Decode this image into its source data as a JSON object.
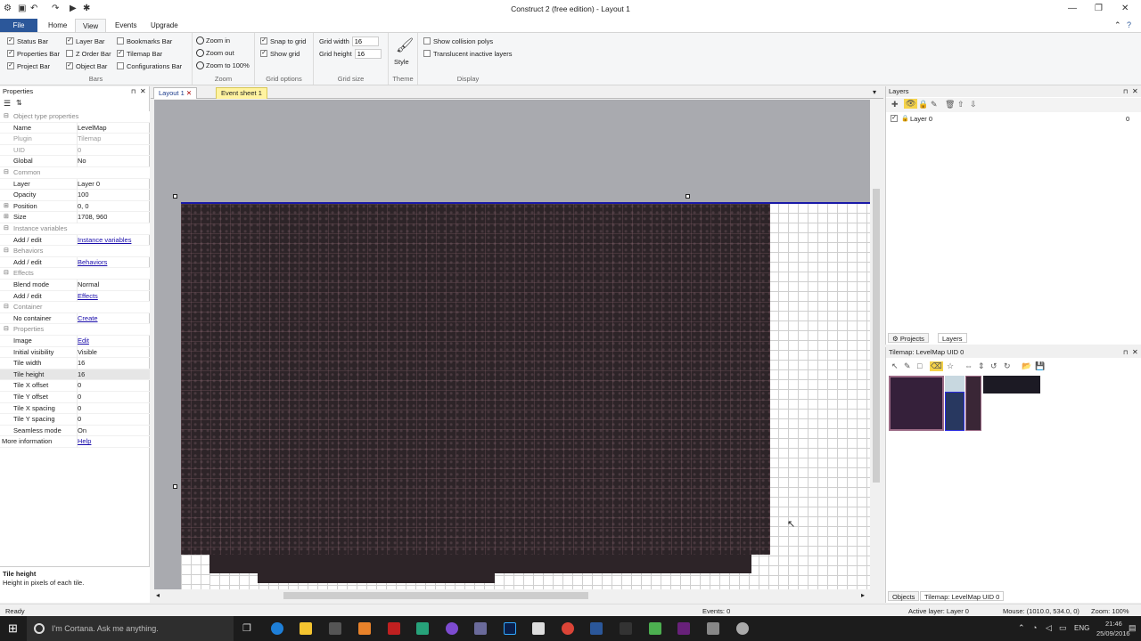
{
  "window": {
    "title": "Construct 2  (free edition) - Layout 1",
    "controls": [
      "minimize-icon",
      "restore-icon",
      "close-icon"
    ]
  },
  "ribbon": {
    "tabs": [
      "File",
      "Home",
      "View",
      "Events",
      "Upgrade"
    ],
    "active_tab": "View",
    "bars": {
      "label": "Bars",
      "items": [
        {
          "label": "Status Bar",
          "checked": true
        },
        {
          "label": "Properties Bar",
          "checked": true
        },
        {
          "label": "Project Bar",
          "checked": true
        },
        {
          "label": "Layer Bar",
          "checked": true
        },
        {
          "label": "Z Order Bar",
          "checked": false
        },
        {
          "label": "Object Bar",
          "checked": true
        },
        {
          "label": "Bookmarks Bar",
          "checked": false
        },
        {
          "label": "Tilemap Bar",
          "checked": true
        },
        {
          "label": "Configurations Bar",
          "checked": false
        }
      ]
    },
    "zoom": {
      "label": "Zoom",
      "items": [
        "Zoom in",
        "Zoom out",
        "Zoom to 100%"
      ]
    },
    "grid_options": {
      "label": "Grid options",
      "items": [
        {
          "label": "Snap to grid",
          "checked": true
        },
        {
          "label": "Show grid",
          "checked": true
        }
      ]
    },
    "grid_size": {
      "label": "Grid size",
      "width_label": "Grid width",
      "width_value": "16",
      "height_label": "Grid height",
      "height_value": "16"
    },
    "theme": {
      "label": "Theme",
      "style_label": "Style"
    },
    "display": {
      "label": "Display",
      "items": [
        {
          "label": "Show collision polys",
          "checked": false
        },
        {
          "label": "Translucent inactive layers",
          "checked": false
        }
      ]
    }
  },
  "properties": {
    "title": "Properties",
    "rows": [
      {
        "type": "cat",
        "key": "Object type properties"
      },
      {
        "key": "Name",
        "value": "LevelMap"
      },
      {
        "key": "Plugin",
        "value": "Tilemap",
        "grey": true
      },
      {
        "key": "UID",
        "value": "0",
        "grey": true
      },
      {
        "key": "Global",
        "value": "No"
      },
      {
        "type": "cat",
        "key": "Common"
      },
      {
        "key": "Layer",
        "value": "Layer 0"
      },
      {
        "key": "Opacity",
        "value": "100"
      },
      {
        "key": "Position",
        "value": "0, 0",
        "expand": true
      },
      {
        "key": "Size",
        "value": "1708, 960",
        "expand": true
      },
      {
        "type": "cat",
        "key": "Instance variables"
      },
      {
        "key": "Add / edit",
        "value": "Instance variables",
        "link": true
      },
      {
        "type": "cat",
        "key": "Behaviors"
      },
      {
        "key": "Add / edit",
        "value": "Behaviors",
        "link": true
      },
      {
        "type": "cat",
        "key": "Effects"
      },
      {
        "key": "Blend mode",
        "value": "Normal"
      },
      {
        "key": "Add / edit",
        "value": "Effects",
        "link": true
      },
      {
        "type": "cat",
        "key": "Container"
      },
      {
        "key": "No container",
        "value": "Create",
        "link": true
      },
      {
        "type": "cat",
        "key": "Properties"
      },
      {
        "key": "Image",
        "value": "Edit",
        "link": true
      },
      {
        "key": "Initial visibility",
        "value": "Visible"
      },
      {
        "key": "Tile width",
        "value": "16"
      },
      {
        "key": "Tile height",
        "value": "16"
      },
      {
        "key": "Tile X offset",
        "value": "0"
      },
      {
        "key": "Tile Y offset",
        "value": "0"
      },
      {
        "key": "Tile X spacing",
        "value": "0"
      },
      {
        "key": "Tile Y spacing",
        "value": "0"
      },
      {
        "key": "Seamless mode",
        "value": "On"
      },
      {
        "key": "More information",
        "value": "Help",
        "link": true,
        "nokeyindent": true
      }
    ],
    "help_title": "Tile height",
    "help_text": "Height in pixels of each tile."
  },
  "editor": {
    "tabs": [
      "Layout 1",
      "Event sheet 1"
    ]
  },
  "layers_panel": {
    "title": "Layers",
    "layers": [
      {
        "name": "Layer 0",
        "count": "0"
      }
    ],
    "bottom_tabs": [
      "Projects",
      "Layers"
    ]
  },
  "tilemap_panel": {
    "title": "Tilemap: LevelMap UID 0",
    "bottom_tabs": [
      "Objects",
      "Tilemap: LevelMap UID 0"
    ]
  },
  "status": {
    "ready": "Ready",
    "events": "Events: 0",
    "active_layer": "Active layer: Layer 0",
    "mouse": "Mouse: (1010.0, 534.0, 0)",
    "zoom": "Zoom: 100%"
  },
  "taskbar": {
    "search_placeholder": "I'm Cortana. Ask me anything.",
    "lang": "ENG",
    "time": "21:46",
    "date": "25/09/2016"
  },
  "colors": {
    "accent": "#2b579a",
    "tilemap": "#2d2428",
    "layout_border": "#1a1aa8"
  }
}
